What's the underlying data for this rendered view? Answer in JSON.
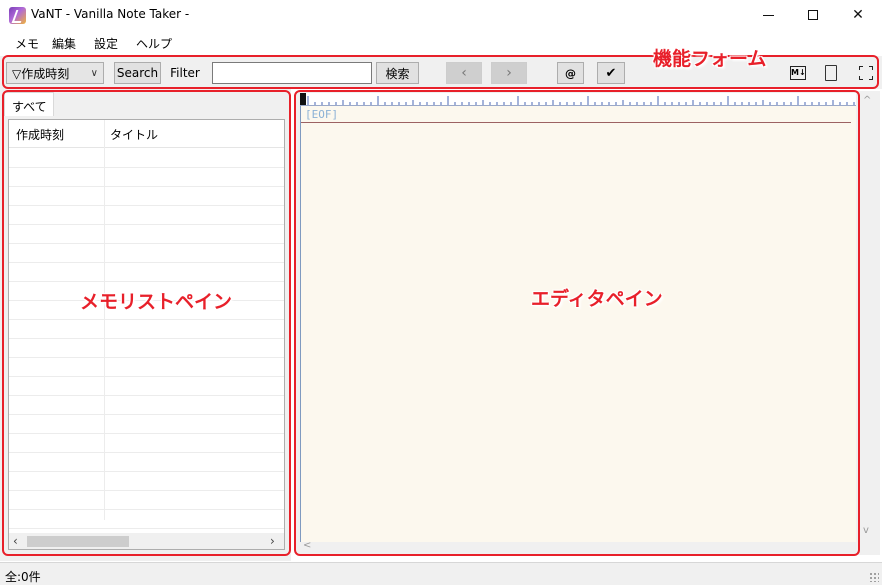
{
  "window": {
    "title": "VaNT - Vanilla Note Taker -",
    "controls": {
      "minimize": "─",
      "maximize": "□",
      "close": "✕"
    }
  },
  "menu": {
    "items": [
      "メモ",
      "編集",
      "設定",
      "ヘルプ"
    ]
  },
  "toolbar": {
    "sort_select": {
      "value": "▽作成時刻",
      "chevron": "∨"
    },
    "search_label": "Search",
    "filter_label": "Filter",
    "search_input": {
      "value": "",
      "placeholder": ""
    },
    "kensaku_label": "検索",
    "prev_label": "‹",
    "next_label": "›",
    "at_label": "@",
    "check_label": "✔",
    "md_label": "M↓"
  },
  "memo_list": {
    "tab_label": "すべて",
    "columns": [
      "作成時刻",
      "タイトル"
    ],
    "rows": [],
    "scroll_left": "‹",
    "scroll_right": "›"
  },
  "editor": {
    "eof_text": "[EOF]",
    "scroll_up": "^",
    "scroll_down": "v",
    "scroll_left": "<"
  },
  "status": {
    "text": "全:0件"
  },
  "annotations": {
    "function_form": "機能フォーム",
    "memo_list_pane": "メモリストペイン",
    "editor_pane": "エディタペイン",
    "color": "#e8202a"
  }
}
